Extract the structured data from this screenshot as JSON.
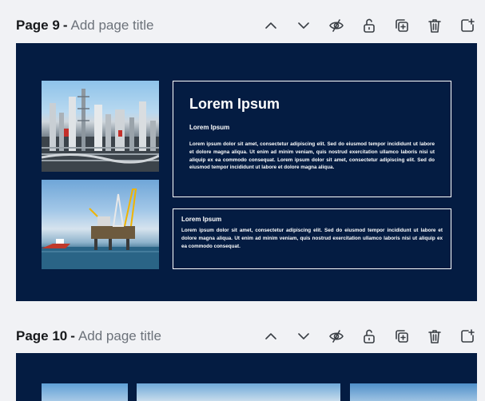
{
  "pages": [
    {
      "number_label": "Page 9",
      "dash": "-",
      "title_placeholder": "Add page title",
      "slide": {
        "photo_top": "industrial refinery photo",
        "photo_bottom": "offshore oil platform photo",
        "box_main": {
          "heading": "Lorem Ipsum",
          "subheading": "Lorem Ipsum",
          "body": "Lorem ipsum dolor sit amet, consectetur adipiscing elit. Sed do eiusmod tempor incididunt ut labore et dolore magna aliqua. Ut enim ad minim veniam, quis nostrud exercitation ullamco laboris nisi ut aliquip ex ea commodo consequat. Lorem ipsum dolor sit amet, consectetur adipiscing elit. Sed do eiusmod tempor incididunt ut labore et dolore magna aliqua."
        },
        "box_secondary": {
          "subheading": "Lorem Ipsum",
          "body": "Lorem ipsum dolor sit amet, consectetur adipiscing elit. Sed do eiusmod tempor incididunt ut labore et dolore magna aliqua. Ut enim ad minim veniam, quis nostrud exercitation ullamco laboris nisi ut aliquip ex ea commodo consequat."
        }
      }
    },
    {
      "number_label": "Page 10",
      "dash": "-",
      "title_placeholder": "Add page title"
    }
  ],
  "toolbar_icons": [
    "chevron-up-icon",
    "chevron-down-icon",
    "eye-hide-icon",
    "unlock-icon",
    "duplicate-icon",
    "trash-icon",
    "add-page-icon"
  ],
  "colors": {
    "slide_background": "#041c42",
    "workspace_background": "#f1f2f5",
    "text_dark": "#17191c",
    "placeholder_gray": "#6c727a"
  }
}
